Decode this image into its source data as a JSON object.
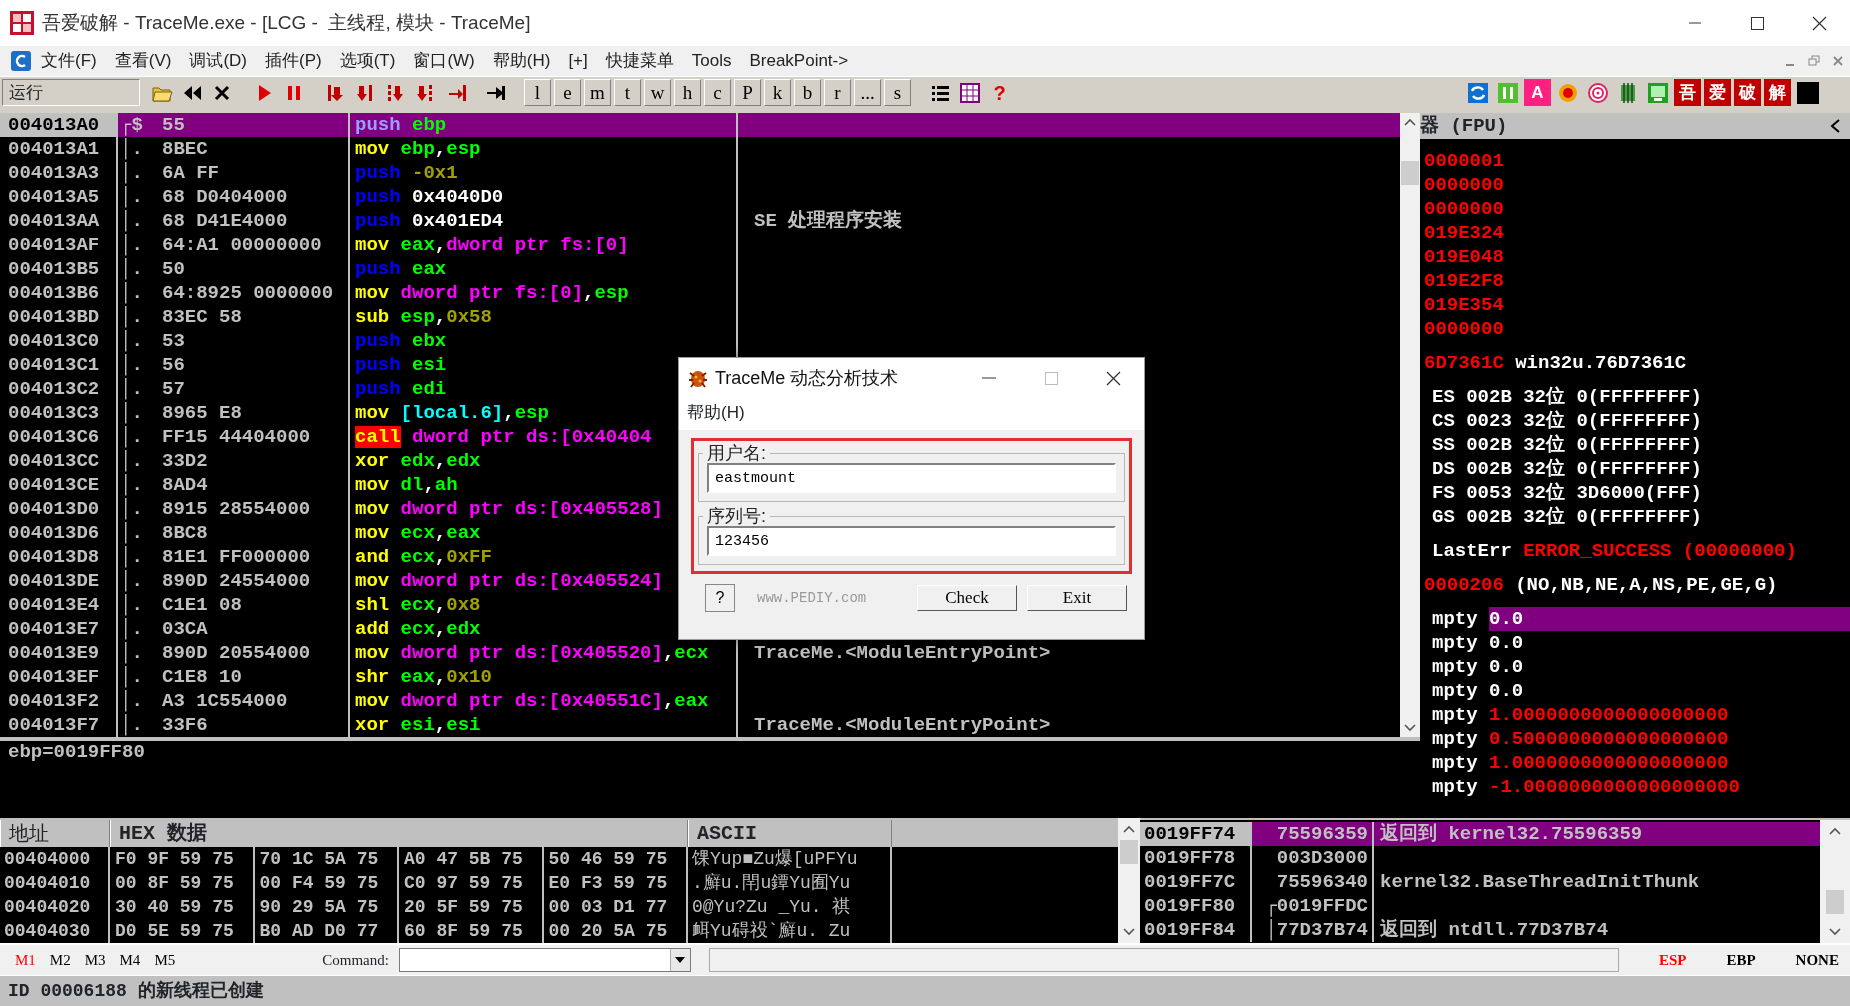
{
  "window": {
    "title": "吾爱破解 - TraceMe.exe - [LCG -  主线程, 模块 - TraceMe]"
  },
  "menu": [
    {
      "label": "文件(F)"
    },
    {
      "label": "查看(V)"
    },
    {
      "label": "调试(D)"
    },
    {
      "label": "插件(P)"
    },
    {
      "label": "选项(T)"
    },
    {
      "label": "窗口(W)"
    },
    {
      "label": "帮助(H)"
    },
    {
      "label": "[+]"
    },
    {
      "label": "快捷菜单"
    },
    {
      "label": "Tools"
    },
    {
      "label": "BreakPoint->"
    }
  ],
  "toolbar": {
    "status": "运行",
    "letter_buttons": [
      "l",
      "e",
      "m",
      "t",
      "w",
      "h",
      "c",
      "P",
      "k",
      "b",
      "r",
      "...",
      "s"
    ],
    "help_glyph": "?",
    "plugin_glyph": "A",
    "brand_buttons": [
      "吾",
      "爱",
      "破",
      "解"
    ]
  },
  "disassembly": {
    "rows": [
      {
        "address": "004013A0",
        "selected": true,
        "marker": "┌$",
        "hex": "55",
        "code": [
          {
            "text": "push",
            "kind": "stack"
          },
          {
            "text": " ebp",
            "kind": "reg"
          }
        ]
      },
      {
        "address": "004013A1",
        "selected": false,
        "marker": "│.",
        "hex": "8BEC",
        "code": [
          {
            "text": "mov",
            "kind": "op"
          },
          {
            "text": " ebp",
            "kind": "reg"
          },
          {
            "text": ",",
            "kind": "plain"
          },
          {
            "text": "esp",
            "kind": "reg"
          }
        ]
      },
      {
        "address": "004013A3",
        "selected": false,
        "marker": "│.",
        "hex": "6A FF",
        "code": [
          {
            "text": "push",
            "kind": "stack"
          },
          {
            "text": " -0x1",
            "kind": "num"
          }
        ]
      },
      {
        "address": "004013A5",
        "selected": false,
        "marker": "│.",
        "hex": "68 D0404000",
        "code": [
          {
            "text": "push",
            "kind": "stack"
          },
          {
            "text": " 0x4040D0",
            "kind": "plain"
          }
        ]
      },
      {
        "address": "004013AA",
        "selected": false,
        "marker": "│.",
        "hex": "68 D41E4000",
        "code": [
          {
            "text": "push",
            "kind": "stack"
          },
          {
            "text": " 0x401ED4",
            "kind": "plain"
          }
        ],
        "comment": "SE 处理程序安装"
      },
      {
        "address": "004013AF",
        "selected": false,
        "marker": "│.",
        "hex": "64:A1 00000000",
        "code": [
          {
            "text": "mov",
            "kind": "op"
          },
          {
            "text": " eax",
            "kind": "reg"
          },
          {
            "text": ",",
            "kind": "plain"
          },
          {
            "text": "dword ptr fs:[0]",
            "kind": "mem"
          }
        ]
      },
      {
        "address": "004013B5",
        "selected": false,
        "marker": "│.",
        "hex": "50",
        "code": [
          {
            "text": "push",
            "kind": "stack"
          },
          {
            "text": " eax",
            "kind": "reg"
          }
        ]
      },
      {
        "address": "004013B6",
        "selected": false,
        "marker": "│.",
        "hex": "64:8925 0000000",
        "code": [
          {
            "text": "mov",
            "kind": "op"
          },
          {
            "text": " dword ptr fs:[0]",
            "kind": "mem"
          },
          {
            "text": ",",
            "kind": "plain"
          },
          {
            "text": "esp",
            "kind": "reg"
          }
        ]
      },
      {
        "address": "004013BD",
        "selected": false,
        "marker": "│.",
        "hex": "83EC 58",
        "code": [
          {
            "text": "sub",
            "kind": "op"
          },
          {
            "text": " esp",
            "kind": "reg"
          },
          {
            "text": ",",
            "kind": "plain"
          },
          {
            "text": "0x58",
            "kind": "num"
          }
        ]
      },
      {
        "address": "004013C0",
        "selected": false,
        "marker": "│.",
        "hex": "53",
        "code": [
          {
            "text": "push",
            "kind": "stack"
          },
          {
            "text": " ebx",
            "kind": "reg"
          }
        ]
      },
      {
        "address": "004013C1",
        "selected": false,
        "marker": "│.",
        "hex": "56",
        "code": [
          {
            "text": "push",
            "kind": "stack"
          },
          {
            "text": " esi",
            "kind": "reg"
          }
        ]
      },
      {
        "address": "004013C2",
        "selected": false,
        "marker": "│.",
        "hex": "57",
        "code": [
          {
            "text": "push",
            "kind": "stack"
          },
          {
            "text": " edi",
            "kind": "reg"
          }
        ]
      },
      {
        "address": "004013C3",
        "selected": false,
        "marker": "│.",
        "hex": "8965 E8",
        "code": [
          {
            "text": "mov",
            "kind": "op"
          },
          {
            "text": " [local.6]",
            "kind": "local"
          },
          {
            "text": ",",
            "kind": "plain"
          },
          {
            "text": "esp",
            "kind": "reg"
          }
        ]
      },
      {
        "address": "004013C6",
        "selected": false,
        "marker": "│.",
        "hex": "FF15 44404000",
        "code": [
          {
            "text": "call",
            "kind": "call"
          },
          {
            "text": " dword ptr ds:[0x40404",
            "kind": "mem"
          }
        ]
      },
      {
        "address": "004013CC",
        "selected": false,
        "marker": "│.",
        "hex": "33D2",
        "code": [
          {
            "text": "xor",
            "kind": "op"
          },
          {
            "text": " edx",
            "kind": "reg"
          },
          {
            "text": ",",
            "kind": "plain"
          },
          {
            "text": "edx",
            "kind": "reg"
          }
        ]
      },
      {
        "address": "004013CE",
        "selected": false,
        "marker": "│.",
        "hex": "8AD4",
        "code": [
          {
            "text": "mov",
            "kind": "op"
          },
          {
            "text": " dl",
            "kind": "reg"
          },
          {
            "text": ",",
            "kind": "plain"
          },
          {
            "text": "ah",
            "kind": "reg"
          }
        ]
      },
      {
        "address": "004013D0",
        "selected": false,
        "marker": "│.",
        "hex": "8915 28554000",
        "code": [
          {
            "text": "mov",
            "kind": "op"
          },
          {
            "text": " dword ptr ds:[0x405528]",
            "kind": "mem"
          }
        ]
      },
      {
        "address": "004013D6",
        "selected": false,
        "marker": "│.",
        "hex": "8BC8",
        "code": [
          {
            "text": "mov",
            "kind": "op"
          },
          {
            "text": " ecx",
            "kind": "reg"
          },
          {
            "text": ",",
            "kind": "plain"
          },
          {
            "text": "eax",
            "kind": "reg"
          }
        ]
      },
      {
        "address": "004013D8",
        "selected": false,
        "marker": "│.",
        "hex": "81E1 FF000000",
        "code": [
          {
            "text": "and",
            "kind": "op"
          },
          {
            "text": " ecx",
            "kind": "reg"
          },
          {
            "text": ",",
            "kind": "plain"
          },
          {
            "text": "0xFF",
            "kind": "num"
          }
        ]
      },
      {
        "address": "004013DE",
        "selected": false,
        "marker": "│.",
        "hex": "890D 24554000",
        "code": [
          {
            "text": "mov",
            "kind": "op"
          },
          {
            "text": " dword ptr ds:[0x405524]",
            "kind": "mem"
          }
        ]
      },
      {
        "address": "004013E4",
        "selected": false,
        "marker": "│.",
        "hex": "C1E1 08",
        "code": [
          {
            "text": "shl",
            "kind": "op"
          },
          {
            "text": " ecx",
            "kind": "reg"
          },
          {
            "text": ",",
            "kind": "plain"
          },
          {
            "text": "0x8",
            "kind": "num"
          }
        ]
      },
      {
        "address": "004013E7",
        "selected": false,
        "marker": "│.",
        "hex": "03CA",
        "code": [
          {
            "text": "add",
            "kind": "op"
          },
          {
            "text": " ecx",
            "kind": "reg"
          },
          {
            "text": ",",
            "kind": "plain"
          },
          {
            "text": "edx",
            "kind": "reg"
          }
        ]
      },
      {
        "address": "004013E9",
        "selected": false,
        "marker": "│.",
        "hex": "890D 20554000",
        "code": [
          {
            "text": "mov",
            "kind": "op"
          },
          {
            "text": " dword ptr ds:[0x405520]",
            "kind": "mem"
          },
          {
            "text": ",",
            "kind": "plain"
          },
          {
            "text": "ecx",
            "kind": "reg"
          }
        ],
        "comment": "TraceMe.<ModuleEntryPoint>"
      },
      {
        "address": "004013EF",
        "selected": false,
        "marker": "│.",
        "hex": "C1E8 10",
        "code": [
          {
            "text": "shr",
            "kind": "op"
          },
          {
            "text": " eax",
            "kind": "reg"
          },
          {
            "text": ",",
            "kind": "plain"
          },
          {
            "text": "0x10",
            "kind": "num"
          }
        ]
      },
      {
        "address": "004013F2",
        "selected": false,
        "marker": "│.",
        "hex": "A3 1C554000",
        "code": [
          {
            "text": "mov",
            "kind": "op"
          },
          {
            "text": " dword ptr ds:[0x40551C]",
            "kind": "mem"
          },
          {
            "text": ",",
            "kind": "plain"
          },
          {
            "text": "eax",
            "kind": "reg"
          }
        ]
      },
      {
        "address": "004013F7",
        "selected": false,
        "marker": "│.",
        "hex": "33F6",
        "code": [
          {
            "text": "xor",
            "kind": "op"
          },
          {
            "text": " esi",
            "kind": "reg"
          },
          {
            "text": ",",
            "kind": "plain"
          },
          {
            "text": "esi",
            "kind": "reg"
          }
        ],
        "comment": "TraceMe.<ModuleEntryPoint>"
      }
    ]
  },
  "info_pane": {
    "text": "ebp=0019FF80"
  },
  "registers": {
    "title": "器 (FPU)",
    "groups": [
      [
        {
          "value": "0000001",
          "changed": true
        },
        {
          "value": "0000000",
          "changed": true
        },
        {
          "value": "0000000",
          "changed": true
        },
        {
          "value": "019E324",
          "changed": true
        },
        {
          "value": "019E048",
          "changed": true
        },
        {
          "value": "019E2F8",
          "changed": true
        },
        {
          "value": "019E354",
          "changed": true
        },
        {
          "value": "0000000",
          "changed": true
        }
      ],
      [
        {
          "value": "6D7361C",
          "changed": true,
          "note": "win32u.76D7361C"
        }
      ],
      [
        {
          "value": "ES 002B 32位 0(FFFFFFFF)",
          "changed": false
        },
        {
          "value": "CS 0023 32位 0(FFFFFFFF)",
          "changed": false
        },
        {
          "value": "SS 002B 32位 0(FFFFFFFF)",
          "changed": false
        },
        {
          "value": "DS 002B 32位 0(FFFFFFFF)",
          "changed": false
        },
        {
          "value": "FS 0053 32位 3D6000(FFF)",
          "changed": false
        },
        {
          "value": "GS 002B 32位 0(FFFFFFFF)",
          "changed": false
        }
      ],
      [
        {
          "label": "LastErr",
          "value": "ERROR_SUCCESS (00000000)",
          "changed": true
        }
      ],
      [
        {
          "value": "0000206",
          "changed": true,
          "note": "(NO,NB,NE,A,NS,PE,GE,G)"
        }
      ],
      [
        {
          "label": "mpty",
          "value": "0.0",
          "changed": false,
          "selected": true
        },
        {
          "label": "mpty",
          "value": "0.0",
          "changed": false,
          "selected": false
        },
        {
          "label": "mpty",
          "value": "0.0",
          "changed": false,
          "selected": false
        },
        {
          "label": "mpty",
          "value": "0.0",
          "changed": false,
          "selected": false
        },
        {
          "label": "mpty",
          "value": "1.0000000000000000000",
          "changed": true,
          "selected": false
        },
        {
          "label": "mpty",
          "value": "0.5000000000000000000",
          "changed": true,
          "selected": false
        },
        {
          "label": "mpty",
          "value": "1.0000000000000000000",
          "changed": true,
          "selected": false
        },
        {
          "label": "mpty",
          "value": "-1.0000000000000000000",
          "changed": true,
          "selected": false
        }
      ]
    ]
  },
  "dump": {
    "columns": [
      "地址",
      "HEX 数据",
      "ASCII"
    ],
    "rows": [
      {
        "address": "00404000",
        "hex": [
          "F0 9F 59 75",
          "70 1C 5A 75",
          "A0 47 5B 75",
          "50 46 59 75"
        ],
        "ascii": "馃Yup■Zu爆[uPFYu"
      },
      {
        "address": "00404010",
        "hex": [
          "00 8F 59 75",
          "00 F4 59 75",
          "C0 97 59 75",
          "E0 F3 59 75"
        ],
        "ascii": ".廯u.閈u鐔Yu囿Yu"
      },
      {
        "address": "00404020",
        "hex": [
          "30 40 59 75",
          "90 29 5A 75",
          "20 5F 59 75",
          "00 03 D1 77"
        ],
        "ascii": "0@Yu?Zu _Yu. 祺"
      },
      {
        "address": "00404030",
        "hex": [
          "D0 5E 59 75",
          "B0 AD D0 77",
          "60 8F 59 75",
          "00 20 5A 75"
        ],
        "ascii": "衈Yu碍祋`廯u. Zu"
      }
    ]
  },
  "stack": {
    "rows": [
      {
        "address": "0019FF74",
        "marker": "",
        "value": "75596359",
        "comment": "返回到 kernel32.75596359",
        "selected": true
      },
      {
        "address": "0019FF78",
        "marker": "",
        "value": "003D3000",
        "selected": false
      },
      {
        "address": "0019FF7C",
        "marker": "",
        "value": "75596340",
        "comment": "kernel32.BaseThreadInitThunk",
        "selected": false
      },
      {
        "address": "0019FF80",
        "marker": "┌",
        "value": "0019FFDC",
        "selected": false
      },
      {
        "address": "0019FF84",
        "marker": "│",
        "value": "77D37B74",
        "comment": "返回到 ntdll.77D37B74",
        "selected": false
      }
    ]
  },
  "command_bar": {
    "marks": [
      {
        "label": "M1",
        "selected": true
      },
      {
        "label": "M2",
        "selected": false
      },
      {
        "label": "M3",
        "selected": false
      },
      {
        "label": "M4",
        "selected": false
      },
      {
        "label": "M5",
        "selected": false
      }
    ],
    "label": "Command:",
    "modes": [
      {
        "label": "ESP",
        "selected": true
      },
      {
        "label": "EBP",
        "selected": false
      },
      {
        "label": "NONE",
        "selected": false
      }
    ]
  },
  "status_bar": {
    "text": "ID 00006188 的新线程已创建"
  },
  "dialog": {
    "title": "TraceMe 动态分析技术",
    "menu": "帮助(H)",
    "groups": [
      {
        "label": "用户名:",
        "value": "eastmount"
      },
      {
        "label": "序列号:",
        "value": "123456"
      }
    ],
    "help_button": "?",
    "site": "www.PEDIY.com",
    "buttons": [
      "Check",
      "Exit"
    ]
  }
}
